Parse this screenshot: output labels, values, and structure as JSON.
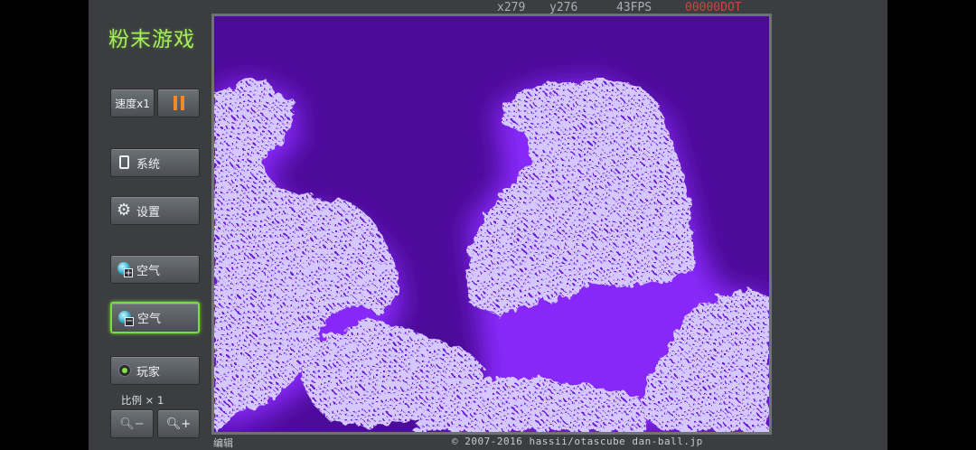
{
  "app": {
    "title": "粉末游戏"
  },
  "hud": {
    "x": "x279",
    "y": "y276",
    "fps": "43FPS",
    "dot": "00000DOT"
  },
  "controls": {
    "speed": "速度x1",
    "system": "系统",
    "settings": "设置",
    "air_add": "空气",
    "air_remove": "空气",
    "player": "玩家",
    "scale": "比例 × 1"
  },
  "icons": {
    "pause": "pause-icon",
    "system": "tablet-icon",
    "settings": "gear-icon",
    "air_add": "air-add-icon",
    "air_remove": "air-remove-icon",
    "player": "player-icon",
    "zoom_out": "zoom-out-icon",
    "zoom_in": "zoom-in-icon"
  },
  "footer": {
    "edit": "编辑",
    "copyright": "© 2007-2016 hassii/otascube dan-ball.jp"
  },
  "colors": {
    "accent": "#a6ef5a",
    "active_border": "#79de3c",
    "pause": "#f08a2a",
    "canvas_bg": "#4d0b9a",
    "powder": "#d5c8ff",
    "glow": "#8b2cff"
  }
}
